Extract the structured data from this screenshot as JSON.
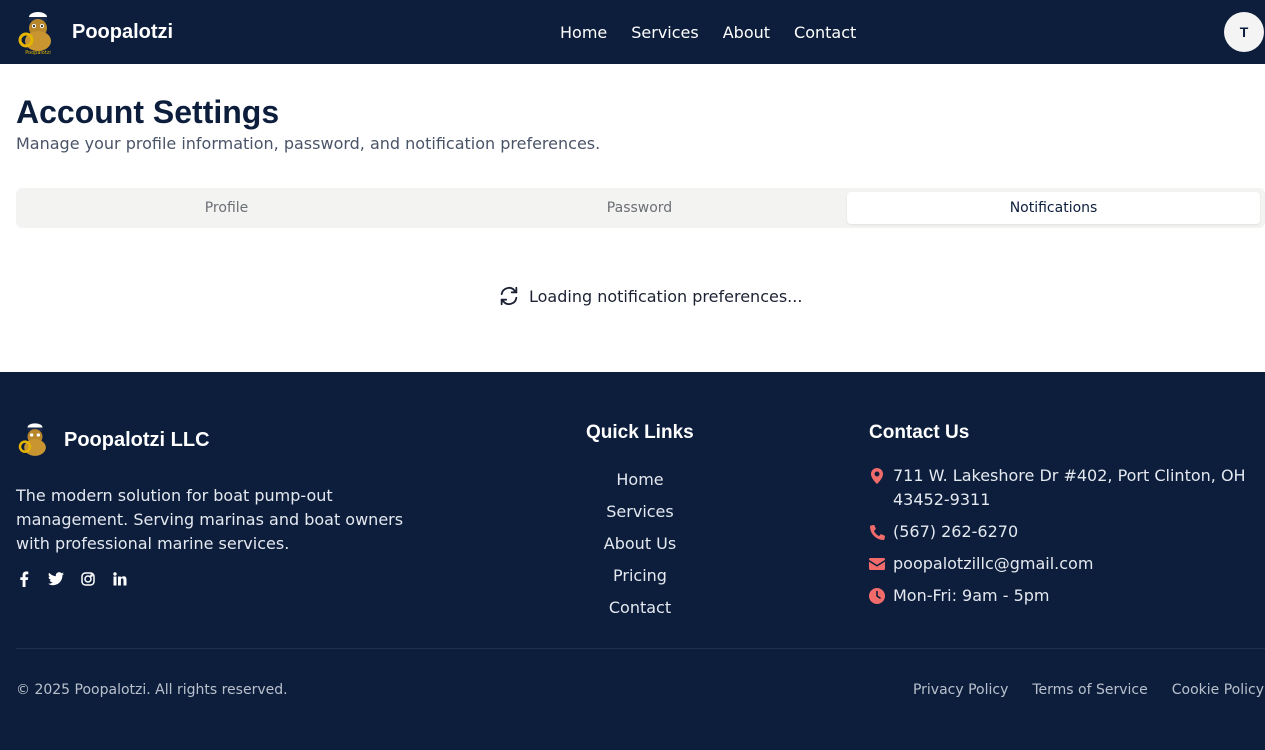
{
  "header": {
    "brand_name": "Poopalotzi",
    "nav": [
      "Home",
      "Services",
      "About",
      "Contact"
    ],
    "avatar_initial": "T"
  },
  "main": {
    "title": "Account Settings",
    "subtitle": "Manage your profile information, password, and notification preferences.",
    "tabs": [
      {
        "label": "Profile",
        "active": false
      },
      {
        "label": "Password",
        "active": false
      },
      {
        "label": "Notifications",
        "active": true
      }
    ],
    "loading_text": "Loading notification preferences..."
  },
  "footer": {
    "brand_name": "Poopalotzi LLC",
    "description": "The modern solution for boat pump-out management. Serving marinas and boat owners with professional marine services.",
    "socials": [
      "facebook-icon",
      "twitter-icon",
      "instagram-icon",
      "linkedin-icon"
    ],
    "quick_links_title": "Quick Links",
    "quick_links": [
      "Home",
      "Services",
      "About Us",
      "Pricing",
      "Contact"
    ],
    "contact_title": "Contact Us",
    "contact": {
      "address": "711 W. Lakeshore Dr #402, Port Clinton, OH 43452-9311",
      "phone": "(567) 262-6270",
      "email": "poopalotzillc@gmail.com",
      "hours": "Mon-Fri: 9am - 5pm"
    },
    "copyright": "© 2025 Poopalotzi. All rights reserved.",
    "legal_links": [
      "Privacy Policy",
      "Terms of Service",
      "Cookie Policy"
    ]
  },
  "colors": {
    "navy": "#0c1e3c",
    "accent_red": "#f26b6b",
    "tab_bg": "#f3f3f1"
  }
}
